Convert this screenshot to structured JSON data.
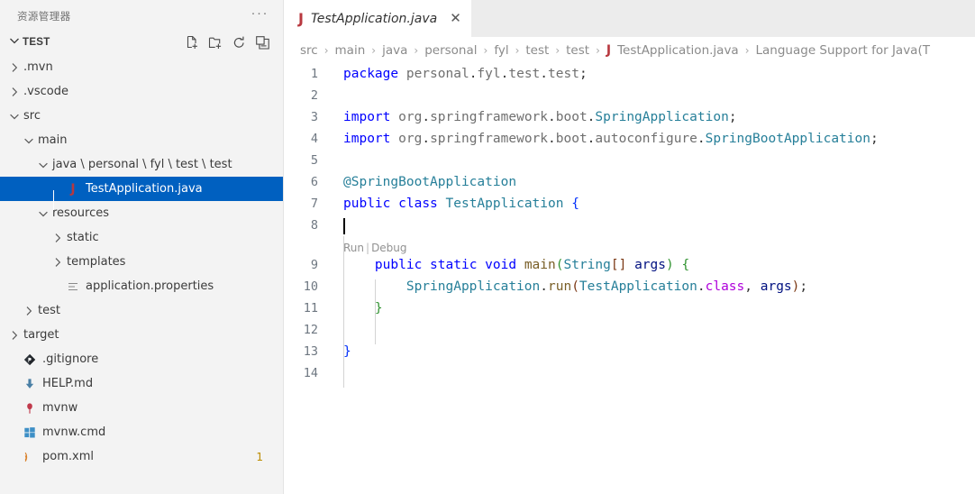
{
  "sidebar": {
    "title": "资源管理器",
    "more_label": "···",
    "section": {
      "label": "TEST",
      "expanded": true,
      "actions": [
        {
          "name": "new-file-icon",
          "tooltip": "新建文件"
        },
        {
          "name": "new-folder-icon",
          "tooltip": "新建文件夹"
        },
        {
          "name": "refresh-icon",
          "tooltip": "刷新资源管理器"
        },
        {
          "name": "collapse-all-icon",
          "tooltip": "在资源管理器中折叠文件夹"
        }
      ]
    },
    "tree": [
      {
        "label": ".mvn",
        "depth": 1,
        "twisty": "collapsed",
        "icon": "none",
        "selected": false,
        "badge": ""
      },
      {
        "label": ".vscode",
        "depth": 1,
        "twisty": "collapsed",
        "icon": "none",
        "selected": false,
        "badge": ""
      },
      {
        "label": "src",
        "depth": 1,
        "twisty": "expanded",
        "icon": "none",
        "selected": false,
        "badge": ""
      },
      {
        "label": "main",
        "depth": 2,
        "twisty": "expanded",
        "icon": "none",
        "selected": false,
        "badge": ""
      },
      {
        "label": "java \\ personal \\ fyl \\ test \\ test",
        "depth": 3,
        "twisty": "expanded",
        "icon": "none",
        "selected": false,
        "badge": ""
      },
      {
        "label": "TestApplication.java",
        "depth": 4,
        "twisty": "none",
        "icon": "java",
        "selected": true,
        "badge": ""
      },
      {
        "label": "resources",
        "depth": 3,
        "twisty": "expanded",
        "icon": "none",
        "selected": false,
        "badge": ""
      },
      {
        "label": "static",
        "depth": 4,
        "twisty": "collapsed",
        "icon": "none",
        "selected": false,
        "badge": ""
      },
      {
        "label": "templates",
        "depth": 4,
        "twisty": "collapsed",
        "icon": "none",
        "selected": false,
        "badge": ""
      },
      {
        "label": "application.properties",
        "depth": 4,
        "twisty": "none",
        "icon": "properties",
        "selected": false,
        "badge": ""
      },
      {
        "label": "test",
        "depth": 2,
        "twisty": "collapsed",
        "icon": "none",
        "selected": false,
        "badge": ""
      },
      {
        "label": "target",
        "depth": 1,
        "twisty": "collapsed",
        "icon": "none",
        "selected": false,
        "badge": ""
      },
      {
        "label": ".gitignore",
        "depth": 1,
        "twisty": "none",
        "icon": "git",
        "selected": false,
        "badge": ""
      },
      {
        "label": "HELP.md",
        "depth": 1,
        "twisty": "none",
        "icon": "markdown",
        "selected": false,
        "badge": ""
      },
      {
        "label": "mvnw",
        "depth": 1,
        "twisty": "none",
        "icon": "mvnw",
        "selected": false,
        "badge": ""
      },
      {
        "label": "mvnw.cmd",
        "depth": 1,
        "twisty": "none",
        "icon": "windows",
        "selected": false,
        "badge": ""
      },
      {
        "label": "pom.xml",
        "depth": 1,
        "twisty": "none",
        "icon": "xml",
        "selected": false,
        "badge": "1"
      }
    ]
  },
  "editor": {
    "tabs": [
      {
        "label": "TestApplication.java",
        "icon": "java-file-icon",
        "active": true,
        "preview": true,
        "close_label": "✕"
      }
    ],
    "breadcrumb": [
      "src",
      "main",
      "java",
      "personal",
      "fyl",
      "test",
      "test",
      "TestApplication.java",
      "Language Support for Java(T"
    ],
    "breadcrumb_separator": "›",
    "codelens": {
      "run": "Run",
      "separator": "|",
      "debug": "Debug"
    },
    "lines": [
      {
        "n": "1",
        "tokens": [
          {
            "t": "package",
            "c": "kw"
          },
          {
            "t": " ",
            "c": "plain"
          },
          {
            "t": "personal",
            "c": "pkg"
          },
          {
            "t": ".",
            "c": "plain"
          },
          {
            "t": "fyl",
            "c": "pkg"
          },
          {
            "t": ".",
            "c": "plain"
          },
          {
            "t": "test",
            "c": "pkg"
          },
          {
            "t": ".",
            "c": "plain"
          },
          {
            "t": "test",
            "c": "pkg"
          },
          {
            "t": ";",
            "c": "plain"
          }
        ]
      },
      {
        "n": "2",
        "tokens": []
      },
      {
        "n": "3",
        "tokens": [
          {
            "t": "import",
            "c": "kw"
          },
          {
            "t": " ",
            "c": "plain"
          },
          {
            "t": "org",
            "c": "pkg"
          },
          {
            "t": ".",
            "c": "plain"
          },
          {
            "t": "springframework",
            "c": "pkg"
          },
          {
            "t": ".",
            "c": "plain"
          },
          {
            "t": "boot",
            "c": "pkg"
          },
          {
            "t": ".",
            "c": "plain"
          },
          {
            "t": "SpringApplication",
            "c": "type"
          },
          {
            "t": ";",
            "c": "plain"
          }
        ]
      },
      {
        "n": "4",
        "tokens": [
          {
            "t": "import",
            "c": "kw"
          },
          {
            "t": " ",
            "c": "plain"
          },
          {
            "t": "org",
            "c": "pkg"
          },
          {
            "t": ".",
            "c": "plain"
          },
          {
            "t": "springframework",
            "c": "pkg"
          },
          {
            "t": ".",
            "c": "plain"
          },
          {
            "t": "boot",
            "c": "pkg"
          },
          {
            "t": ".",
            "c": "plain"
          },
          {
            "t": "autoconfigure",
            "c": "pkg"
          },
          {
            "t": ".",
            "c": "plain"
          },
          {
            "t": "SpringBootApplication",
            "c": "type"
          },
          {
            "t": ";",
            "c": "plain"
          }
        ]
      },
      {
        "n": "5",
        "tokens": []
      },
      {
        "n": "6",
        "tokens": [
          {
            "t": "@SpringBootApplication",
            "c": "ann"
          }
        ]
      },
      {
        "n": "7",
        "tokens": [
          {
            "t": "public",
            "c": "kw"
          },
          {
            "t": " ",
            "c": "plain"
          },
          {
            "t": "class",
            "c": "kw"
          },
          {
            "t": " ",
            "c": "plain"
          },
          {
            "t": "TestApplication",
            "c": "type"
          },
          {
            "t": " ",
            "c": "plain"
          },
          {
            "t": "{",
            "c": "br1"
          }
        ]
      },
      {
        "n": "8",
        "tokens": []
      },
      {
        "n": "9",
        "tokens": [
          {
            "t": "    ",
            "c": "plain"
          },
          {
            "t": "public",
            "c": "kw"
          },
          {
            "t": " ",
            "c": "plain"
          },
          {
            "t": "static",
            "c": "kw"
          },
          {
            "t": " ",
            "c": "plain"
          },
          {
            "t": "void",
            "c": "kw"
          },
          {
            "t": " ",
            "c": "plain"
          },
          {
            "t": "main",
            "c": "fn"
          },
          {
            "t": "(",
            "c": "br2"
          },
          {
            "t": "String",
            "c": "type"
          },
          {
            "t": "[]",
            "c": "br3"
          },
          {
            "t": " ",
            "c": "plain"
          },
          {
            "t": "args",
            "c": "var"
          },
          {
            "t": ")",
            "c": "br2"
          },
          {
            "t": " ",
            "c": "plain"
          },
          {
            "t": "{",
            "c": "br2"
          }
        ]
      },
      {
        "n": "10",
        "tokens": [
          {
            "t": "        ",
            "c": "plain"
          },
          {
            "t": "SpringApplication",
            "c": "type"
          },
          {
            "t": ".",
            "c": "plain"
          },
          {
            "t": "run",
            "c": "fn"
          },
          {
            "t": "(",
            "c": "br3"
          },
          {
            "t": "TestApplication",
            "c": "type"
          },
          {
            "t": ".",
            "c": "plain"
          },
          {
            "t": "class",
            "c": "ctl"
          },
          {
            "t": ",",
            "c": "plain"
          },
          {
            "t": " ",
            "c": "plain"
          },
          {
            "t": "args",
            "c": "var"
          },
          {
            "t": ")",
            "c": "br3"
          },
          {
            "t": ";",
            "c": "plain"
          }
        ]
      },
      {
        "n": "11",
        "tokens": [
          {
            "t": "    ",
            "c": "plain"
          },
          {
            "t": "}",
            "c": "br2"
          }
        ]
      },
      {
        "n": "12",
        "tokens": []
      },
      {
        "n": "13",
        "tokens": [
          {
            "t": "}",
            "c": "br1"
          }
        ]
      },
      {
        "n": "14",
        "tokens": []
      }
    ]
  },
  "colors": {
    "sidebar_bg": "#F3F3F3",
    "selection_bg": "#0060C0",
    "tabbar_bg": "#ECECEC",
    "editor_bg": "#FFFFFF",
    "keyword": "#0000FF",
    "type": "#267F99",
    "function": "#795E26",
    "control": "#AF00DB",
    "variable": "#001080",
    "badge": "#BC8C00"
  }
}
